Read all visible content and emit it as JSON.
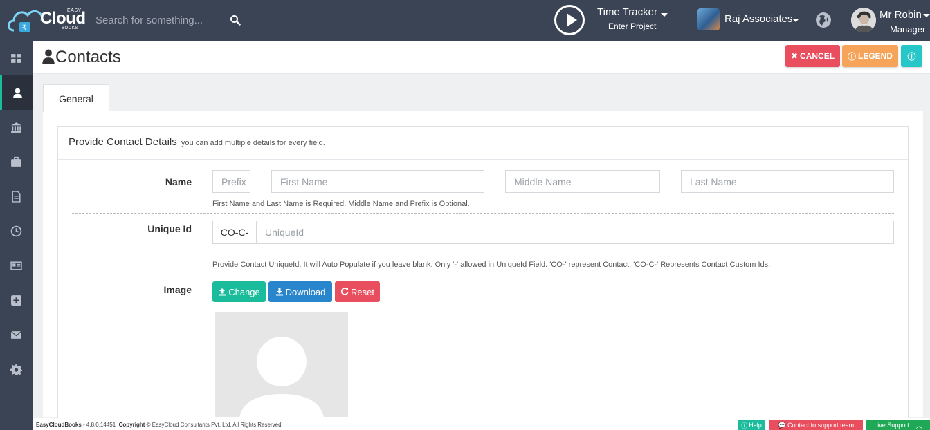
{
  "brand": {
    "easy": "EASY",
    "cloud": "Cloud",
    "books": "BOOKS"
  },
  "search": {
    "placeholder": "Search for something..."
  },
  "time_tracker": {
    "title": "Time Tracker",
    "subtitle": "Enter Project"
  },
  "company": {
    "name": "Raj Associates"
  },
  "user": {
    "name": "Mr Robin",
    "role": "Manager"
  },
  "sidebar": {
    "items": [
      {
        "icon": "dashboard-icon"
      },
      {
        "icon": "user-icon",
        "active": true
      },
      {
        "icon": "bank-icon"
      },
      {
        "icon": "briefcase-icon"
      },
      {
        "icon": "document-icon"
      },
      {
        "icon": "clock-icon"
      },
      {
        "icon": "card-icon"
      },
      {
        "icon": "plus-square-icon"
      },
      {
        "icon": "envelope-icon"
      },
      {
        "icon": "gear-icon"
      }
    ]
  },
  "page": {
    "title": "Contacts"
  },
  "actions": {
    "cancel": "CANCEL",
    "legend": "LEGEND"
  },
  "tabs": [
    {
      "label": "General"
    }
  ],
  "panel": {
    "title": "Provide Contact Details",
    "subtitle": "you can add multiple details for every field."
  },
  "form": {
    "name_label": "Name",
    "prefix_placeholder": "Prefix",
    "first_placeholder": "First Name",
    "middle_placeholder": "Middle Name",
    "last_placeholder": "Last Name",
    "name_help": "First Name and Last Name is Required. Middle Name and Prefix is Optional.",
    "unique_label": "Unique Id",
    "unique_prefix": "CO-C-",
    "unique_placeholder": "UniqueId",
    "unique_help": "Provide Contact UniqueId. It will Auto Populate if you leave blank. Only '-' allowed in UniqueId Field. 'CO-' represent Contact. 'CO-C-' Represents Contact Custom Ids.",
    "image_label": "Image",
    "change": "Change",
    "download": "Download",
    "reset": "Reset"
  },
  "footer": {
    "app": "EasyCloudBooks",
    "version": "- 4.8.0.14451",
    "copyright_label": "Copyright",
    "copyright_text": "© EasyCloud Consultants Pvt. Ltd. All Rights Reserved",
    "help": "Help",
    "support": "Contact to support team",
    "live": "Live Support"
  },
  "colors": {
    "navbar": "#3b4454",
    "accent": "#1abc9c",
    "danger": "#e94e5f",
    "warning": "#f5a45a",
    "info": "#26c6c9",
    "primary": "#2a86cc",
    "live": "#1fa855"
  }
}
